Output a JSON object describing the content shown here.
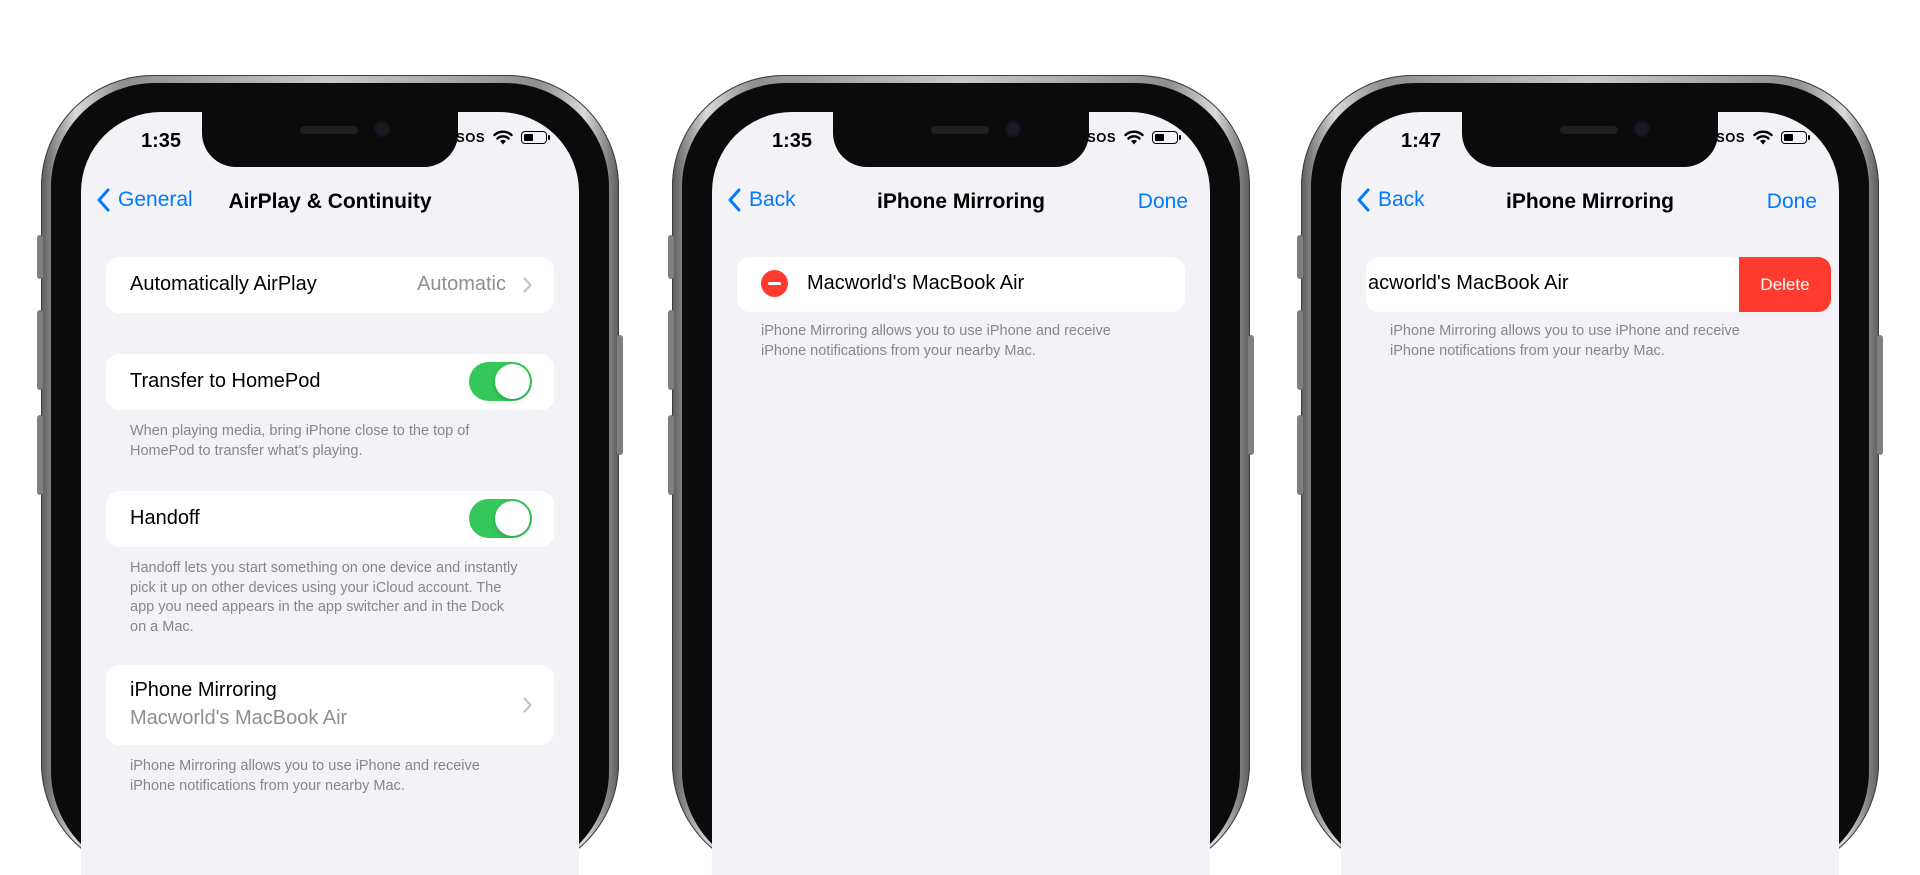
{
  "colors": {
    "accent": "#007aff",
    "toggle_on": "#34c759",
    "destructive": "#ff3b30",
    "background": "#f2f2f7",
    "secondary_text": "#86868b"
  },
  "phone1": {
    "status": {
      "time": "1:35",
      "sos": "SOS"
    },
    "nav": {
      "back": "General",
      "title": "AirPlay & Continuity"
    },
    "automatically_airplay": {
      "label": "Automatically AirPlay",
      "value": "Automatic"
    },
    "transfer_homepod": {
      "label": "Transfer to HomePod",
      "toggle": "on",
      "footer": "When playing media, bring iPhone close to the top of HomePod to transfer what's playing."
    },
    "handoff": {
      "label": "Handoff",
      "toggle": "on",
      "footer": "Handoff lets you start something on one device and instantly pick it up on other devices using your iCloud account. The app you need appears in the app switcher and in the Dock on a Mac."
    },
    "iphone_mirroring": {
      "label": "iPhone Mirroring",
      "subtitle": "Macworld's MacBook Air",
      "footer": "iPhone Mirroring allows you to use iPhone and receive iPhone notifications from your nearby Mac."
    }
  },
  "phone2": {
    "status": {
      "time": "1:35",
      "sos": "SOS"
    },
    "nav": {
      "back": "Back",
      "title": "iPhone Mirroring",
      "done": "Done"
    },
    "device": {
      "label": "Macworld's MacBook Air"
    },
    "footer": "iPhone Mirroring allows you to use iPhone and receive iPhone notifications from your nearby Mac."
  },
  "phone3": {
    "status": {
      "time": "1:47",
      "sos": "SOS"
    },
    "nav": {
      "back": "Back",
      "title": "iPhone Mirroring",
      "done": "Done"
    },
    "device": {
      "label": "acworld's MacBook Air",
      "delete": "Delete"
    },
    "footer": "iPhone Mirroring allows you to use iPhone and receive iPhone notifications from your nearby Mac."
  }
}
